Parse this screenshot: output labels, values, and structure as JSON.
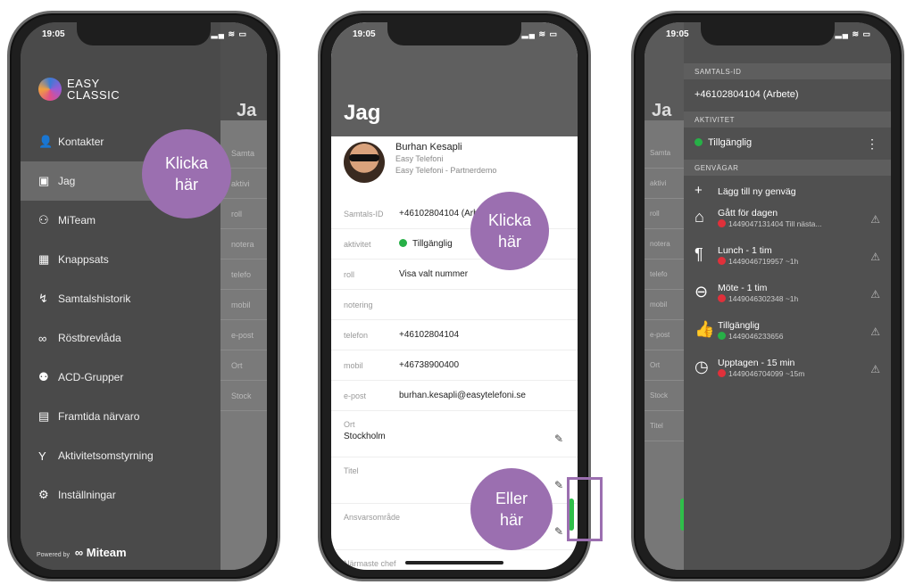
{
  "phone1": {
    "status_time": "19:05",
    "status_icons": "▂▄ ≋ ▭",
    "logo": {
      "line1": "EASY",
      "line2": "CLASSIC"
    },
    "menu": [
      {
        "icon": "👤",
        "label": "Kontakter"
      },
      {
        "icon": "▣",
        "label": "Jag"
      },
      {
        "icon": "⚇",
        "label": "MiTeam"
      },
      {
        "icon": "▦",
        "label": "Knappsats"
      },
      {
        "icon": "↯",
        "label": "Samtalshistorik"
      },
      {
        "icon": "∞",
        "label": "Röstbrevlåda"
      },
      {
        "icon": "⚉",
        "label": "ACD-Grupper"
      },
      {
        "icon": "▤",
        "label": "Framtida närvaro"
      },
      {
        "icon": "Y",
        "label": "Aktivitetsomstyrning"
      },
      {
        "icon": "⚙",
        "label": "Inställningar"
      }
    ],
    "powered_by": "Powered by",
    "powered_brand": "∞ Miteam",
    "behind_title": "Ja",
    "behind_rows": [
      "Samta",
      "aktivi",
      "roll",
      "notera",
      "telefo",
      "mobil",
      "e-post",
      "Ort",
      "Stock"
    ],
    "callout": {
      "line1": "Klicka",
      "line2": "här"
    }
  },
  "phone2": {
    "status_time": "19:05",
    "status_icons": "▂▄ ≋ ▭",
    "title": "Jag",
    "profile": {
      "name": "Burhan Kesapli",
      "line2": "Easy Telefoni",
      "line3": "Easy Telefoni - Partnerdemo"
    },
    "rows": [
      {
        "label": "Samtals-ID",
        "value": "+46102804104 (Arbete)"
      },
      {
        "label": "aktivitet",
        "value": "Tillgänglig"
      },
      {
        "label": "roll",
        "value": "Visa valt nummer"
      },
      {
        "label": "notering",
        "value": ""
      },
      {
        "label": "telefon",
        "value": "+46102804104"
      },
      {
        "label": "mobil",
        "value": "+46738900400"
      },
      {
        "label": "e-post",
        "value": "burhan.kesapli@easytelefoni.se"
      }
    ],
    "editable": [
      {
        "label": "Ort",
        "value": "Stockholm"
      },
      {
        "label": "Titel",
        "value": ""
      },
      {
        "label": "Ansvarsområde",
        "value": ""
      },
      {
        "label": "Närmaste chef",
        "value": ""
      }
    ],
    "callout1": {
      "line1": "Klicka",
      "line2": "här"
    },
    "callout2": {
      "line1": "Eller",
      "line2": "här"
    }
  },
  "phone3": {
    "status_time": "19:05",
    "status_icons": "▂▄ ≋ ▭",
    "behind_title": "Ja",
    "behind_rows": [
      "Samta",
      "aktivi",
      "roll",
      "notera",
      "telefo",
      "mobil",
      "e-post",
      "Ort",
      "Stock",
      "Titel"
    ],
    "sec_callid": "SAMTALS-ID",
    "callid": "+46102804104 (Arbete)",
    "sec_activity": "AKTIVITET",
    "activity": "Tillgänglig",
    "sec_shortcuts": "GENVÄGAR",
    "add_shortcut": "Lägg till ny genväg",
    "shortcuts": [
      {
        "icon": "⌂",
        "title": "Gått för dagen",
        "sub": "1449047131404 Till nästa...",
        "dot": "red"
      },
      {
        "icon": "¶",
        "title": "Lunch - 1 tim",
        "sub": "1449046719957 ~1h",
        "dot": "red"
      },
      {
        "icon": "⊖",
        "title": "Möte - 1 tim",
        "sub": "1449046302348 ~1h",
        "dot": "red"
      },
      {
        "icon": "👍",
        "title": "Tillgänglig",
        "sub": "1449046233656",
        "dot": "green"
      },
      {
        "icon": "◷",
        "title": "Upptagen - 15 min",
        "sub": "1449046704099 ~15m",
        "dot": "red"
      }
    ]
  },
  "colors": {
    "accent": "#9b6fb0",
    "available": "#27b047",
    "busy": "#e0303a"
  }
}
